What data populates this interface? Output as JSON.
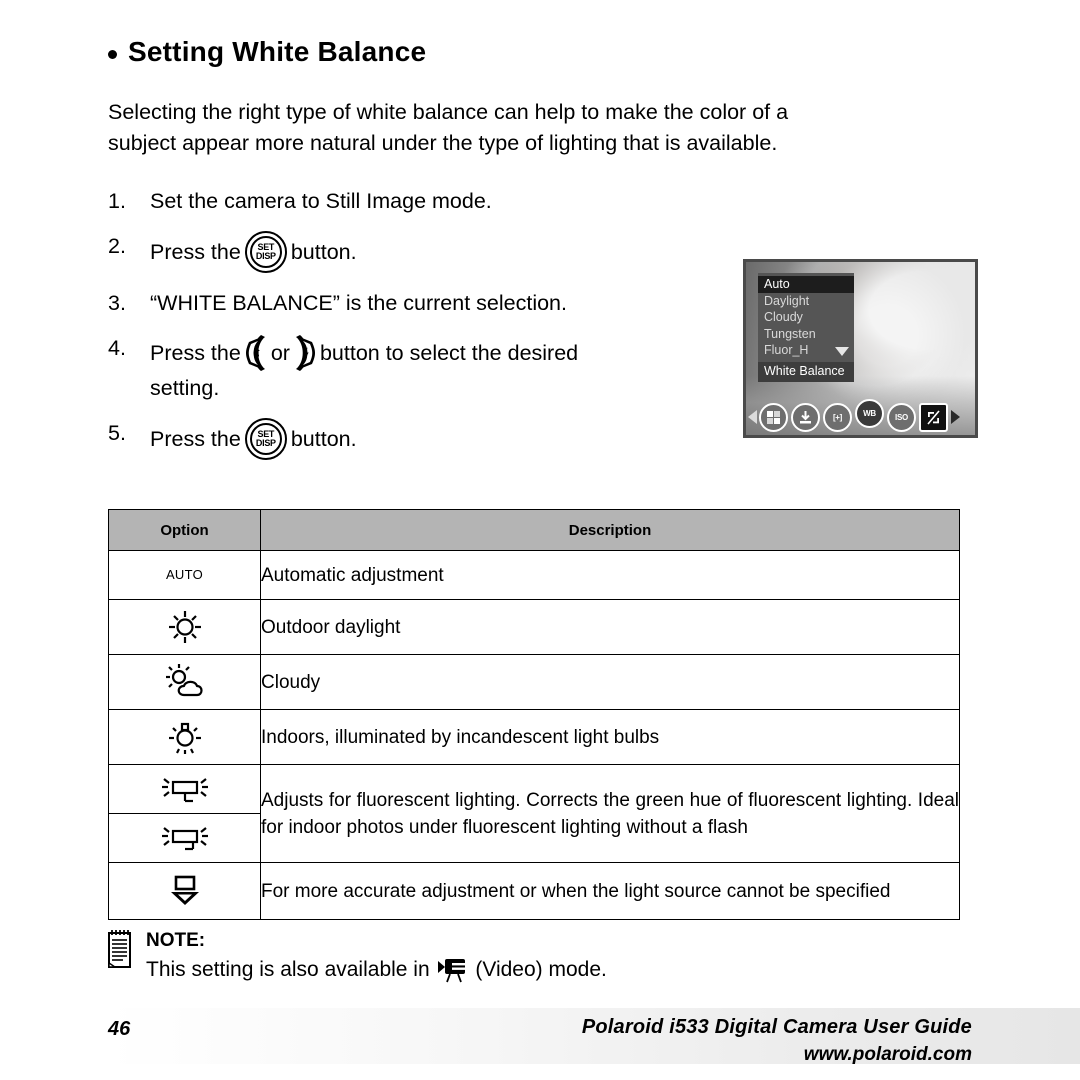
{
  "heading": {
    "bullet": "bullet-dot",
    "title": "Setting White Balance"
  },
  "intro": {
    "line1": "Selecting the right type of white balance can help to make the color of a",
    "line2": "subject appear more natural under the type of lighting that is available."
  },
  "steps": [
    {
      "num": "1.",
      "text_before": "Set the camera to Still Image mode.",
      "icon": "",
      "text_after": ""
    },
    {
      "num": "2.",
      "text_before": "Press the",
      "icon": "setdisp-button-icon",
      "text_after": "button."
    },
    {
      "num": "3.",
      "text_before": "“WHITE BALANCE” is the current selection.",
      "icon": "",
      "text_after": ""
    },
    {
      "num": "4.",
      "text_before": "Press the",
      "icon": "left-right-keys",
      "mid": "or",
      "text_after": "button to select the desired",
      "text_line2": "setting."
    },
    {
      "num": "5.",
      "text_before": "Press the",
      "icon": "setdisp-button-icon",
      "text_after": "button."
    }
  ],
  "setdisp_button": {
    "top": "SET",
    "bottom": "DISP"
  },
  "lcd": {
    "menu_items": [
      {
        "label": "Auto",
        "selected": true
      },
      {
        "label": "Daylight",
        "selected": false
      },
      {
        "label": "Cloudy",
        "selected": false
      },
      {
        "label": "Tungsten",
        "selected": false
      },
      {
        "label": "Fluor_H",
        "selected": false,
        "caret": true
      }
    ],
    "menu_title": "White Balance",
    "toolbar": [
      {
        "name": "prev-arrow",
        "label": ""
      },
      {
        "name": "resolution-icon",
        "label": ""
      },
      {
        "name": "quality-icon",
        "label": ""
      },
      {
        "name": "focus-icon",
        "label": "[+]"
      },
      {
        "name": "white-balance-icon",
        "label": "WB"
      },
      {
        "name": "iso-icon",
        "label": "ISO"
      },
      {
        "name": "exposure-icon",
        "label": ""
      },
      {
        "name": "next-arrow",
        "label": ""
      }
    ]
  },
  "table": {
    "headers": {
      "option": "Option",
      "description": "Description"
    },
    "rows": [
      {
        "icon": "auto-text-icon",
        "icon_label": "AUTO",
        "description": "Automatic adjustment"
      },
      {
        "icon": "sun-daylight-icon",
        "icon_label": "",
        "description": "Outdoor daylight"
      },
      {
        "icon": "sun-cloud-icon",
        "icon_label": "",
        "description": "Cloudy"
      },
      {
        "icon": "light-bulb-icon",
        "icon_label": "",
        "description": "Indoors, illuminated by incandescent light bulbs"
      },
      {
        "icon": "fluorescent-h-icon",
        "icon_label": "",
        "description": "Adjusts for fluorescent lighting. Corrects the green hue of fluorescent lighting. Ideal for indoor photos under fluorescent lighting without a flash",
        "merged": true
      },
      {
        "icon": "fluorescent-l-icon",
        "icon_label": "",
        "description": "",
        "merged_continuation": true
      },
      {
        "icon": "custom-wb-icon",
        "icon_label": "",
        "description": "For more accurate adjustment or when the light source cannot be specified"
      }
    ]
  },
  "note": {
    "icon": "notepad-icon",
    "title": "NOTE:",
    "text_before": "This setting is also available in",
    "inline_icon": "video-camera-icon",
    "text_after": "(Video) mode."
  },
  "footer": {
    "page_number": "46",
    "guide_title": "Polaroid i533 Digital Camera User Guide",
    "url": "www.polaroid.com"
  }
}
